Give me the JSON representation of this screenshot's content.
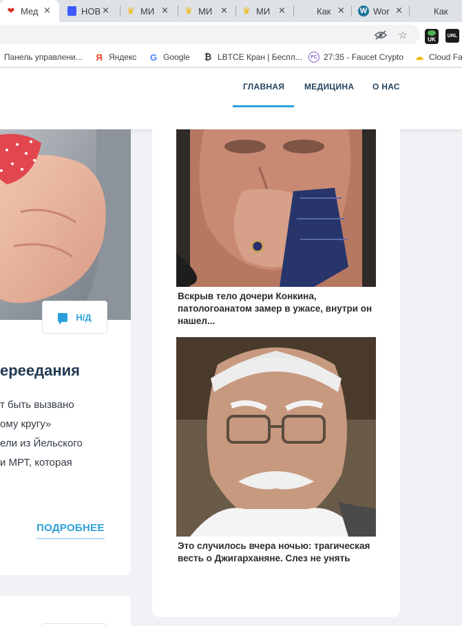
{
  "browser": {
    "tabs": [
      {
        "title": "Мед",
        "icon": "heart-favicon",
        "active": true
      },
      {
        "title": "НОВ",
        "icon": "document-favicon"
      },
      {
        "title": "МИ",
        "icon": "crown-favicon"
      },
      {
        "title": "МИ",
        "icon": "crown-favicon"
      },
      {
        "title": "МИ",
        "icon": "crown-favicon"
      },
      {
        "title": "Как",
        "icon": "blank-favicon"
      },
      {
        "title": "Wor",
        "icon": "wordpress-favicon"
      },
      {
        "title": "Как",
        "icon": "blank-favicon"
      }
    ],
    "close_glyph": "×",
    "extensions": {
      "uk_badge": "UK",
      "url_badge": "URL"
    },
    "bookmarks": [
      {
        "label": "Панель управлени...",
        "icon": "folder-icon"
      },
      {
        "label": "Яндекс",
        "icon": "yandex-icon",
        "glyph": "Я"
      },
      {
        "label": "Google",
        "icon": "google-icon",
        "glyph": "G"
      },
      {
        "label": "LBTCE Кран | Беспл...",
        "icon": "bitcoin-icon",
        "glyph": "₿"
      },
      {
        "label": "27:35 - Faucet Crypto",
        "icon": "faucetcrypto-icon",
        "glyph": "FC"
      },
      {
        "label": "Cloud Fa",
        "icon": "cloud-icon",
        "glyph": "☁"
      }
    ]
  },
  "site": {
    "nav": [
      {
        "label": "ГЛАВНАЯ",
        "active": true
      },
      {
        "label": "МЕДИЦИНА"
      },
      {
        "label": "О НАС"
      }
    ]
  },
  "main_article": {
    "comments_label": "Н/Д",
    "title": "ереедания",
    "excerpt": [
      "т быть вызвано",
      "ому кругу»",
      "ели из Йельского",
      "и МРТ, которая"
    ],
    "more_label": "ПОДРОБНЕЕ"
  },
  "sidebar_news": [
    {
      "title": "Вскрыв тело дочери Конкина, патологоанатом замер в ужасе, внутри он нашел...",
      "image": "crying-elderly-man-photo"
    },
    {
      "title": "Это случилось вчера ночью: трагическая весть о Джигарханяне. Слез не унять",
      "image": "elderly-man-glasses-photo"
    }
  ],
  "colors": {
    "accent": "#2aa0db",
    "nav_text": "#24435f",
    "title_text": "#1f3a52"
  }
}
